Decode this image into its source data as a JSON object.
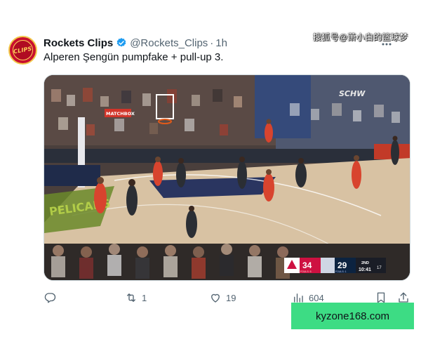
{
  "tweet": {
    "display_name": "Rockets Clips",
    "handle": "@Rockets_Clips",
    "separator": "·",
    "time": "1h",
    "text": "Alperen Şengün pumpfake + pull-up 3.",
    "avatar_text": "CLIPS"
  },
  "watermark": {
    "text": "搜狐号@萧小白的篮球梦"
  },
  "scoreboard": {
    "home_score": "34",
    "home_fouls": "FOULS: 5",
    "away_score": "29",
    "away_fouls": "FOULS: 1",
    "period": "2ND",
    "clock": "10:41",
    "shot_clock": "17"
  },
  "arena_signs": {
    "sign_left": "MATCHBOX",
    "sign_right": "SCHW",
    "floor_logo": "PELICANS"
  },
  "actions": {
    "reply_count": "",
    "retweet_count": "1",
    "like_count": "19",
    "views_count": "604"
  },
  "site_badge": {
    "text": "kyzone168.com"
  },
  "colors": {
    "accent": "#1d9bf0",
    "text_secondary": "#536471",
    "badge_green": "#3ddc84",
    "rockets_red": "#ce1141"
  }
}
